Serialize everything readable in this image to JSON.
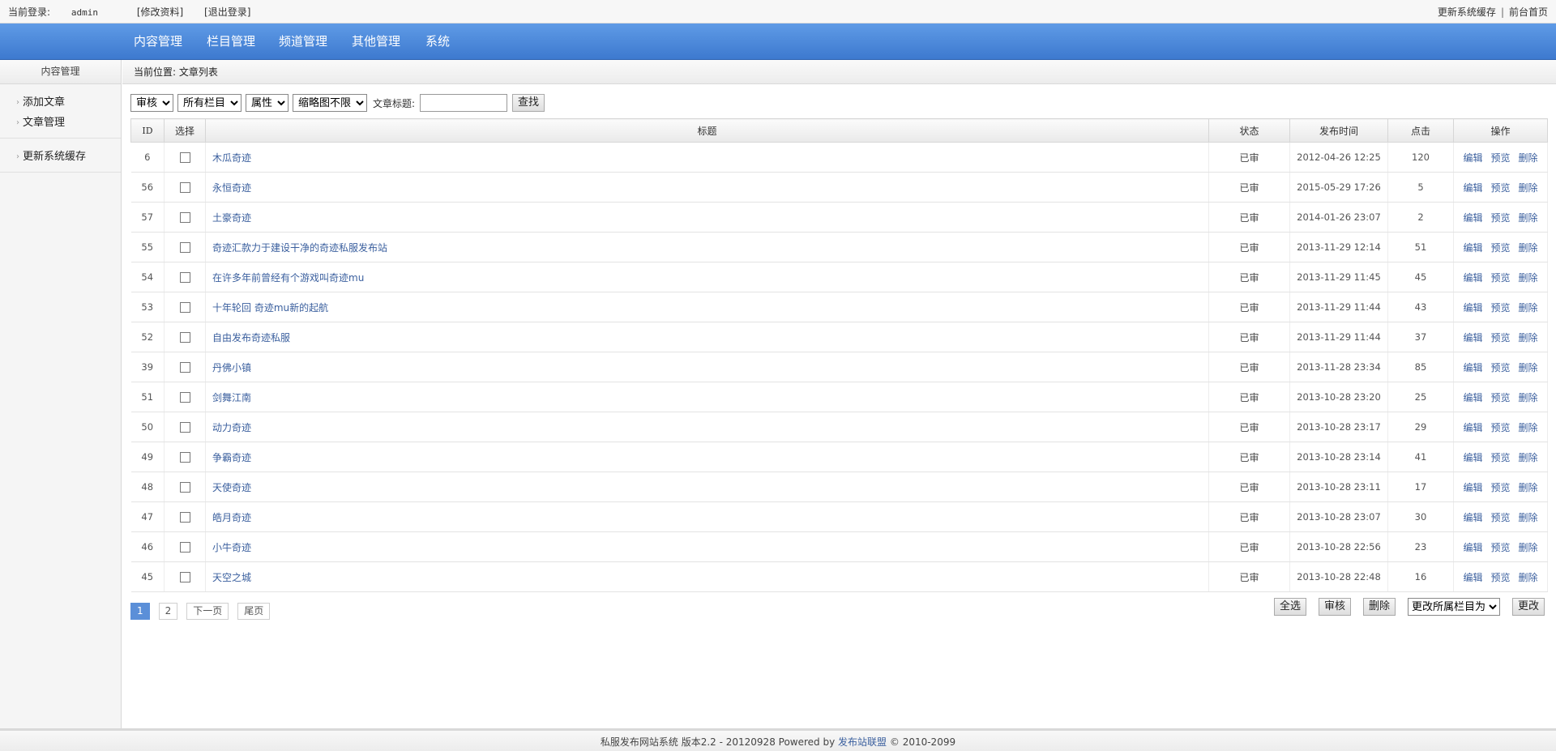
{
  "topbar": {
    "login_label": "当前登录:",
    "username": "admin",
    "edit_profile": "[修改资料]",
    "logout": "[退出登录]",
    "update_cache": "更新系统缓存",
    "separator": "|",
    "front_home": "前台首页"
  },
  "nav": {
    "items": [
      "内容管理",
      "栏目管理",
      "频道管理",
      "其他管理",
      "系统"
    ]
  },
  "sidebar": {
    "title": "内容管理",
    "group1": [
      "添加文章",
      "文章管理"
    ],
    "group2": [
      "更新系统缓存"
    ]
  },
  "breadcrumb": "当前位置: 文章列表",
  "filter": {
    "audit_select": "审核",
    "column_select": "所有栏目",
    "attr_select": "属性",
    "thumb_select": "缩略图不限",
    "title_label": "文章标题:",
    "title_value": "",
    "search_button": "查找"
  },
  "table": {
    "headers": {
      "id": "ID",
      "select": "选择",
      "title": "标题",
      "status": "状态",
      "time": "发布时间",
      "clicks": "点击",
      "ops": "操作"
    },
    "op_labels": {
      "edit": "编辑",
      "preview": "预览",
      "delete": "删除"
    },
    "rows": [
      {
        "id": "6",
        "title": "木瓜奇迹",
        "status": "已审",
        "time": "2012-04-26 12:25",
        "clicks": "120"
      },
      {
        "id": "56",
        "title": "永恒奇迹",
        "status": "已审",
        "time": "2015-05-29 17:26",
        "clicks": "5"
      },
      {
        "id": "57",
        "title": "土豪奇迹",
        "status": "已审",
        "time": "2014-01-26 23:07",
        "clicks": "2"
      },
      {
        "id": "55",
        "title": "奇迹汇款力于建设干净的奇迹私服发布站",
        "status": "已审",
        "time": "2013-11-29 12:14",
        "clicks": "51"
      },
      {
        "id": "54",
        "title": "在许多年前曾经有个游戏叫奇迹mu",
        "status": "已审",
        "time": "2013-11-29 11:45",
        "clicks": "45"
      },
      {
        "id": "53",
        "title": "十年轮回 奇迹mu新的起航",
        "status": "已审",
        "time": "2013-11-29 11:44",
        "clicks": "43"
      },
      {
        "id": "52",
        "title": "自由发布奇迹私服",
        "status": "已审",
        "time": "2013-11-29 11:44",
        "clicks": "37"
      },
      {
        "id": "39",
        "title": "丹佛小镇",
        "status": "已审",
        "time": "2013-11-28 23:34",
        "clicks": "85"
      },
      {
        "id": "51",
        "title": "剑舞江南",
        "status": "已审",
        "time": "2013-10-28 23:20",
        "clicks": "25"
      },
      {
        "id": "50",
        "title": "动力奇迹",
        "status": "已审",
        "time": "2013-10-28 23:17",
        "clicks": "29"
      },
      {
        "id": "49",
        "title": "争霸奇迹",
        "status": "已审",
        "time": "2013-10-28 23:14",
        "clicks": "41"
      },
      {
        "id": "48",
        "title": "天使奇迹",
        "status": "已审",
        "time": "2013-10-28 23:11",
        "clicks": "17"
      },
      {
        "id": "47",
        "title": "皓月奇迹",
        "status": "已审",
        "time": "2013-10-28 23:07",
        "clicks": "30"
      },
      {
        "id": "46",
        "title": "小牛奇迹",
        "status": "已审",
        "time": "2013-10-28 22:56",
        "clicks": "23"
      },
      {
        "id": "45",
        "title": "天空之城",
        "status": "已审",
        "time": "2013-10-28 22:48",
        "clicks": "16"
      }
    ]
  },
  "pager": {
    "pages": [
      "1",
      "2"
    ],
    "current": "1",
    "next": "下一页",
    "last": "尾页"
  },
  "bulk": {
    "select_all": "全选",
    "audit": "审核",
    "delete": "删除",
    "move_select": "更改所属栏目为",
    "change": "更改"
  },
  "footer": {
    "text": "私服发布网站系统 版本2.2 - 20120928 Powered by",
    "link": "发布站联盟",
    "copyright": "© 2010-2099"
  }
}
